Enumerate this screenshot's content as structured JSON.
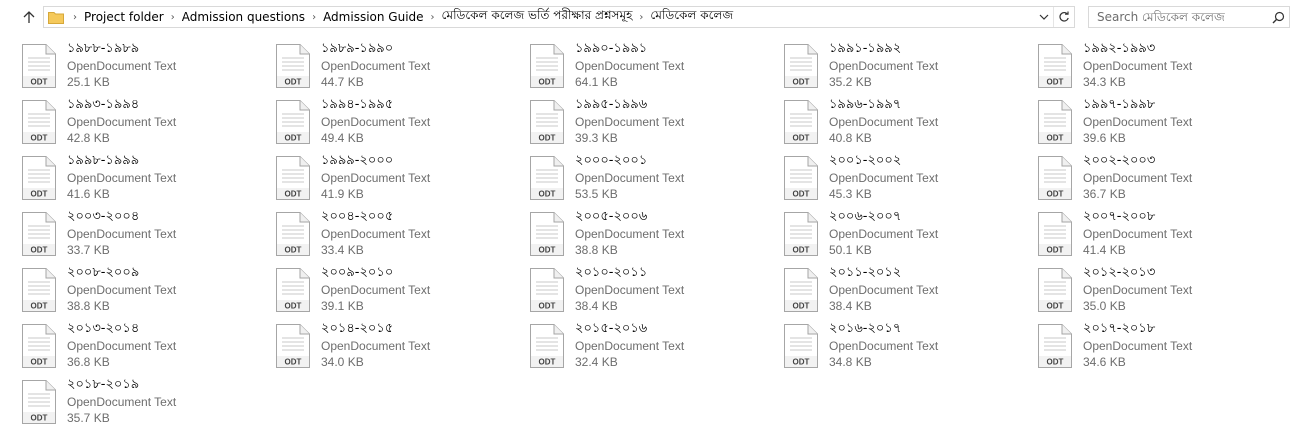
{
  "nav": {
    "up_icon": "arrow-up-icon",
    "breadcrumbs": [
      "Project folder",
      "Admission questions",
      "Admission Guide",
      "মেডিকেল কলেজ ভর্তি পরীক্ষার প্রশ্নসমূহ",
      "মেডিকেল কলেজ"
    ],
    "search_placeholder": "Search মেডিকেল কলেজ"
  },
  "colors": {
    "accent": "#1f6fc0",
    "folder": "#f5c95b",
    "muted_text": "#6d6d6d"
  },
  "file_type_badge": "ODT",
  "files": [
    {
      "name": "১৯৮৮-১৯৮৯",
      "type": "OpenDocument Text",
      "size": "25.1 KB"
    },
    {
      "name": "১৯৮৯-১৯৯০",
      "type": "OpenDocument Text",
      "size": "44.7 KB"
    },
    {
      "name": "১৯৯০-১৯৯১",
      "type": "OpenDocument Text",
      "size": "64.1 KB"
    },
    {
      "name": "১৯৯১-১৯৯২",
      "type": "OpenDocument Text",
      "size": "35.2 KB"
    },
    {
      "name": "১৯৯২-১৯৯৩",
      "type": "OpenDocument Text",
      "size": "34.3 KB"
    },
    {
      "name": "১৯৯৩-১৯৯৪",
      "type": "OpenDocument Text",
      "size": "42.8 KB"
    },
    {
      "name": "১৯৯৪-১৯৯৫",
      "type": "OpenDocument Text",
      "size": "49.4 KB"
    },
    {
      "name": "১৯৯৫-১৯৯৬",
      "type": "OpenDocument Text",
      "size": "39.3 KB"
    },
    {
      "name": "১৯৯৬-১৯৯৭",
      "type": "OpenDocument Text",
      "size": "40.8 KB"
    },
    {
      "name": "১৯৯৭-১৯৯৮",
      "type": "OpenDocument Text",
      "size": "39.6 KB"
    },
    {
      "name": "১৯৯৮-১৯৯৯",
      "type": "OpenDocument Text",
      "size": "41.6 KB"
    },
    {
      "name": "১৯৯৯-২০০০",
      "type": "OpenDocument Text",
      "size": "41.9 KB"
    },
    {
      "name": "২০০০-২০০১",
      "type": "OpenDocument Text",
      "size": "53.5 KB"
    },
    {
      "name": "২০০১-২০০২",
      "type": "OpenDocument Text",
      "size": "45.3 KB"
    },
    {
      "name": "২০০২-২০০৩",
      "type": "OpenDocument Text",
      "size": "36.7 KB"
    },
    {
      "name": "২০০৩-২০০৪",
      "type": "OpenDocument Text",
      "size": "33.7 KB"
    },
    {
      "name": "২০০৪-২০০৫",
      "type": "OpenDocument Text",
      "size": "33.4 KB"
    },
    {
      "name": "২০০৫-২০০৬",
      "type": "OpenDocument Text",
      "size": "38.8 KB"
    },
    {
      "name": "২০০৬-২০০৭",
      "type": "OpenDocument Text",
      "size": "50.1 KB"
    },
    {
      "name": "২০০৭-২০০৮",
      "type": "OpenDocument Text",
      "size": "41.4 KB"
    },
    {
      "name": "২০০৮-২০০৯",
      "type": "OpenDocument Text",
      "size": "38.8 KB"
    },
    {
      "name": "২০০৯-২০১০",
      "type": "OpenDocument Text",
      "size": "39.1 KB"
    },
    {
      "name": "২০১০-২০১১",
      "type": "OpenDocument Text",
      "size": "38.4 KB"
    },
    {
      "name": "২০১১-২০১২",
      "type": "OpenDocument Text",
      "size": "38.4 KB"
    },
    {
      "name": "২০১২-২০১৩",
      "type": "OpenDocument Text",
      "size": "35.0 KB"
    },
    {
      "name": "২০১৩-২০১৪",
      "type": "OpenDocument Text",
      "size": "36.8 KB"
    },
    {
      "name": "২০১৪-২০১৫",
      "type": "OpenDocument Text",
      "size": "34.0 KB"
    },
    {
      "name": "২০১৫-২০১৬",
      "type": "OpenDocument Text",
      "size": "32.4 KB"
    },
    {
      "name": "২০১৬-২০১৭",
      "type": "OpenDocument Text",
      "size": "34.8 KB"
    },
    {
      "name": "২০১৭-২০১৮",
      "type": "OpenDocument Text",
      "size": "34.6 KB"
    },
    {
      "name": "২০১৮-২০১৯",
      "type": "OpenDocument Text",
      "size": "35.7 KB"
    }
  ]
}
